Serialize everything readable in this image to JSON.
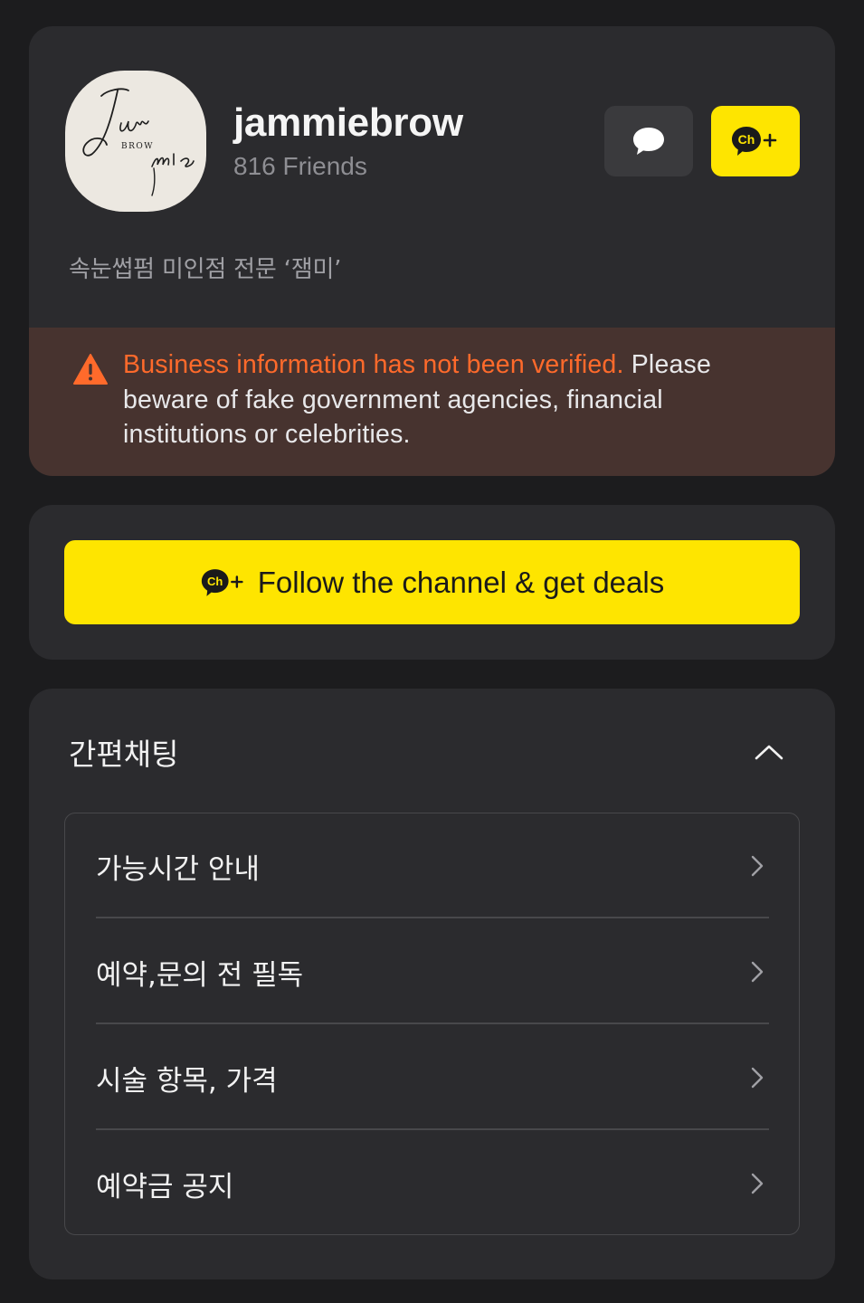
{
  "profile": {
    "name": "jammiebrow",
    "friends": "816 Friends",
    "description": "속눈썹펌 미인점 전문  ‘잼미’",
    "logo_text": {
      "line1": "Jam",
      "line2": "BROW",
      "line3": "mie"
    },
    "chat_button_icon": "speech-bubble-icon",
    "add_channel_icon": "channel-add-icon"
  },
  "warning": {
    "highlight": "Business information has not been verified.",
    "message": " Please beware of fake government agencies, financial institutions or celebrities."
  },
  "follow": {
    "label": "Follow the channel & get deals"
  },
  "quick_chat": {
    "title": "간편채팅",
    "items": [
      {
        "label": "가능시간 안내"
      },
      {
        "label": "예약,문의 전 필독"
      },
      {
        "label": "시술 항목, 가격"
      },
      {
        "label": "예약금 공지"
      }
    ]
  },
  "colors": {
    "background": "#1c1c1e",
    "card": "#2b2b2e",
    "kakao_yellow": "#fee500",
    "warning_bg": "#47332f",
    "warning_accent": "#ff6a2b"
  }
}
